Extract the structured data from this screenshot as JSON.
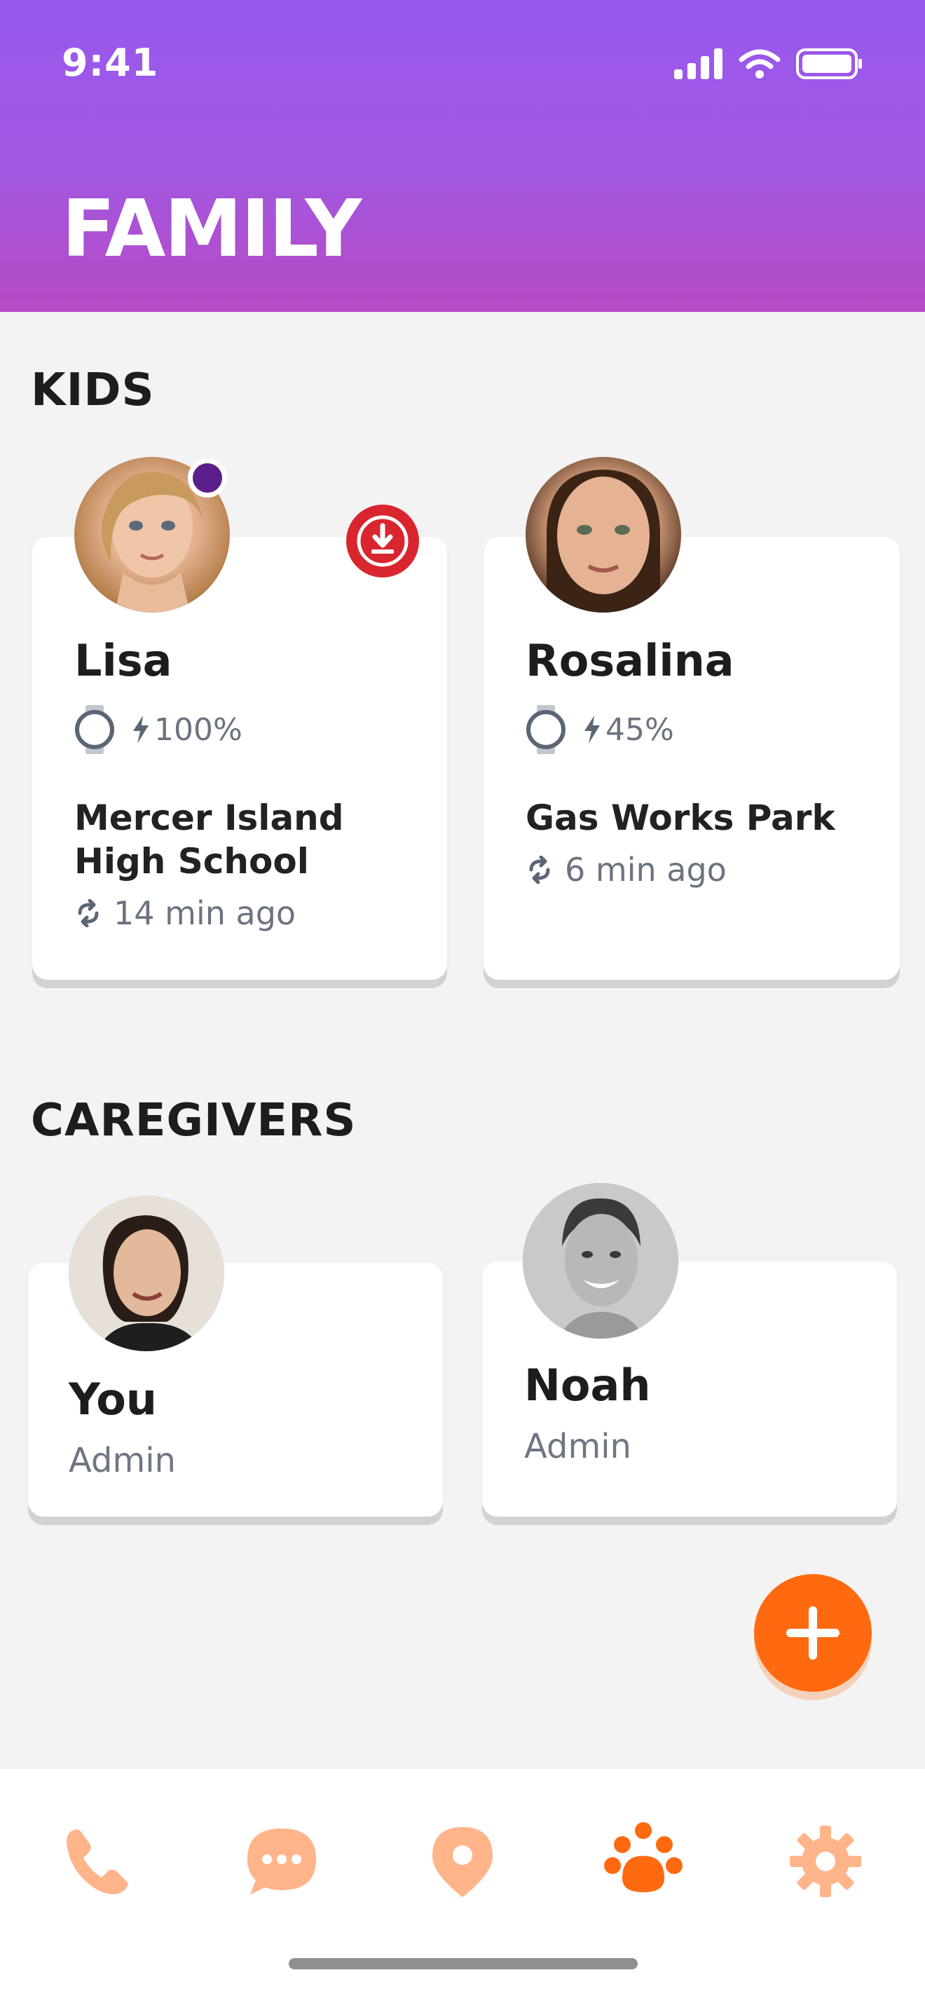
{
  "status_bar": {
    "time": "9:41"
  },
  "header": {
    "title": "FAMILY"
  },
  "kids": {
    "section_title": "KIDS",
    "items": [
      {
        "name": "Lisa",
        "battery": "100%",
        "location_line1": "Mercer Island",
        "location_line2": "High School",
        "updated": "14 min ago"
      },
      {
        "name": "Rosalina",
        "battery": "45%",
        "location_line1": "Gas Works Park",
        "location_line2": "",
        "updated": "6 min ago"
      }
    ]
  },
  "caregivers": {
    "section_title": "CAREGIVERS",
    "items": [
      {
        "name": "You",
        "role": "Admin"
      },
      {
        "name": "Noah",
        "role": "Admin"
      }
    ]
  },
  "fab": {
    "icon": "plus-icon"
  },
  "tabbar": {
    "tabs": [
      {
        "icon": "phone-icon",
        "active": false
      },
      {
        "icon": "chat-icon",
        "active": false
      },
      {
        "icon": "location-pin-icon",
        "active": false
      },
      {
        "icon": "family-icon",
        "active": true
      },
      {
        "icon": "gear-icon",
        "active": false
      }
    ]
  },
  "colors": {
    "header_gradient_top": "#9758ee",
    "header_gradient_bottom": "#b74bc4",
    "accent_orange": "#ff6a10",
    "tab_inactive": "#ffb48a",
    "badge_red": "#d9262e",
    "online_dot": "#5b1f8c"
  }
}
